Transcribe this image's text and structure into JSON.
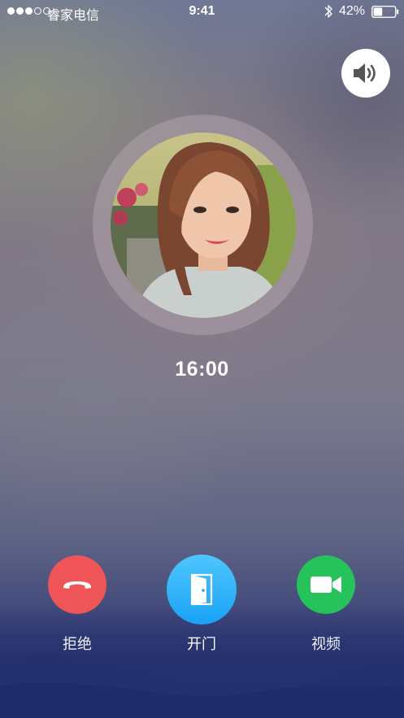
{
  "status_bar": {
    "signal_dots_filled": 3,
    "signal_dots_total": 5,
    "carrier": "睿家电信",
    "time": "9:41",
    "battery_percent": "42%",
    "battery_level": 0.42
  },
  "speaker": {
    "icon": "speaker-icon"
  },
  "caller": {
    "avatar": "caller-photo"
  },
  "call_timer": "16:00",
  "actions": {
    "reject": {
      "label": "拒绝",
      "icon": "hang-up-icon",
      "color": "#ef5458"
    },
    "open_door": {
      "label": "开门",
      "icon": "door-icon",
      "color": "#22a9f6"
    },
    "video": {
      "label": "视频",
      "icon": "video-camera-icon",
      "color": "#25c35a"
    }
  }
}
